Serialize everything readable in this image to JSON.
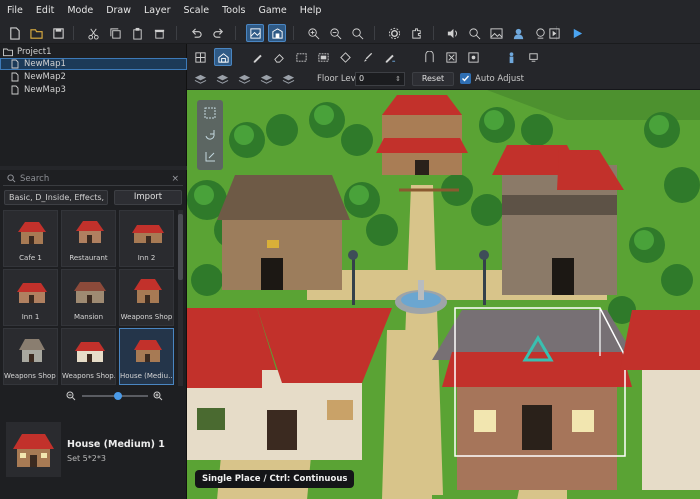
{
  "menu": [
    "File",
    "Edit",
    "Mode",
    "Draw",
    "Layer",
    "Scale",
    "Tools",
    "Game",
    "Help"
  ],
  "project": {
    "name": "Project1",
    "maps": [
      "NewMap1",
      "NewMap2",
      "NewMap3"
    ],
    "selected_map": "NewMap1"
  },
  "search": {
    "placeholder": "Search"
  },
  "filter": {
    "value": "Basic, D_Inside, Effects, I..."
  },
  "import_label": "Import",
  "tiles": [
    {
      "label": "Cafe 1"
    },
    {
      "label": "Restaurant"
    },
    {
      "label": "Inn 2"
    },
    {
      "label": "Inn 1"
    },
    {
      "label": "Mansion"
    },
    {
      "label": "Weapons Shop"
    },
    {
      "label": "Weapons Shop 2"
    },
    {
      "label": "Weapons Shop..."
    },
    {
      "label": "House (Mediu..."
    }
  ],
  "selected_asset": {
    "name": "House (Medium) 1",
    "set": "Set 5*2*3"
  },
  "floor": {
    "label": "Floor Level",
    "value": "0"
  },
  "reset_label": "Reset",
  "auto_adjust": {
    "label": "Auto Adjust",
    "checked": true
  },
  "status": "Single Place / Ctrl: Continuous",
  "colors": {
    "accent": "#2f6fb3",
    "grass": "#5aa334",
    "roof": "#c2312b",
    "path": "#d8c48a"
  }
}
